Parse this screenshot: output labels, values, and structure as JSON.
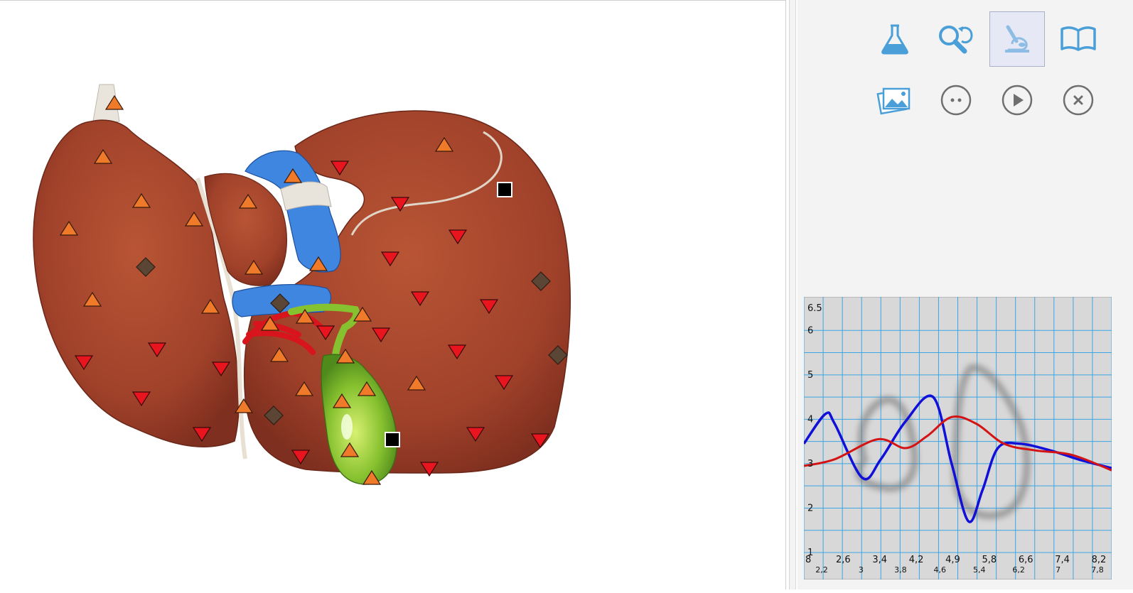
{
  "toolbar": {
    "row1": [
      {
        "name": "flask-icon",
        "active": false
      },
      {
        "name": "magnifier-rotate-icon",
        "active": false
      },
      {
        "name": "microscope-icon",
        "active": true
      },
      {
        "name": "open-book-icon",
        "active": false
      }
    ],
    "row2": [
      {
        "name": "photo-stack-icon",
        "active": false
      },
      {
        "name": "ellipsis-circle-icon",
        "active": false
      },
      {
        "name": "play-circle-icon",
        "active": false
      },
      {
        "name": "close-circle-icon",
        "active": false
      }
    ],
    "icon_color": "#4a9fd8",
    "active_icon_color": "#8dbde4",
    "grey_icon_color": "#6f6f6f"
  },
  "colors": {
    "liver": "#a8452c",
    "gallbladder": "#7fbf2e",
    "vessel_blue": "#3f86e0",
    "artery_red": "#d8141c",
    "marker_up": "#ee7a2a",
    "marker_down": "#e8141e",
    "marker_diamond": "#5b4636",
    "marker_square": "#000000"
  },
  "chart_data": {
    "type": "line",
    "y_ticks": [
      "6.5",
      "6",
      "5",
      "4",
      "3",
      "2",
      "1"
    ],
    "y_values": [
      6.5,
      6,
      5,
      4,
      3,
      2,
      1
    ],
    "ylim": [
      1,
      6.5
    ],
    "x_top_labels": [
      "8",
      "2,6",
      "3,4",
      "4,2",
      "4,9",
      "5,8",
      "6,6",
      "7,4",
      "8,2"
    ],
    "x_bottom_labels": [
      "2,2",
      "3",
      "3,8",
      "4,6",
      "5,4",
      "6,2",
      "7",
      "7,8"
    ],
    "grid": true,
    "background": "#d8d8d8",
    "grid_color": "#3aa6e6",
    "series": [
      {
        "color": "#1010d8",
        "points": [
          [
            0,
            3.45
          ],
          [
            0.07,
            4.12
          ],
          [
            0.1,
            3.9
          ],
          [
            0.19,
            2.68
          ],
          [
            0.25,
            3.1
          ],
          [
            0.33,
            3.95
          ],
          [
            0.42,
            4.5
          ],
          [
            0.48,
            3.0
          ],
          [
            0.535,
            1.7
          ],
          [
            0.58,
            2.4
          ],
          [
            0.63,
            3.35
          ],
          [
            0.7,
            3.45
          ],
          [
            0.8,
            3.3
          ],
          [
            0.9,
            3.08
          ],
          [
            1.0,
            2.9
          ]
        ]
      },
      {
        "color": "#d41414",
        "points": [
          [
            0,
            2.95
          ],
          [
            0.1,
            3.1
          ],
          [
            0.24,
            3.55
          ],
          [
            0.33,
            3.35
          ],
          [
            0.4,
            3.62
          ],
          [
            0.48,
            4.05
          ],
          [
            0.56,
            3.9
          ],
          [
            0.65,
            3.45
          ],
          [
            0.75,
            3.3
          ],
          [
            0.87,
            3.2
          ],
          [
            1.0,
            2.85
          ]
        ]
      }
    ],
    "shadow_loops": true
  }
}
